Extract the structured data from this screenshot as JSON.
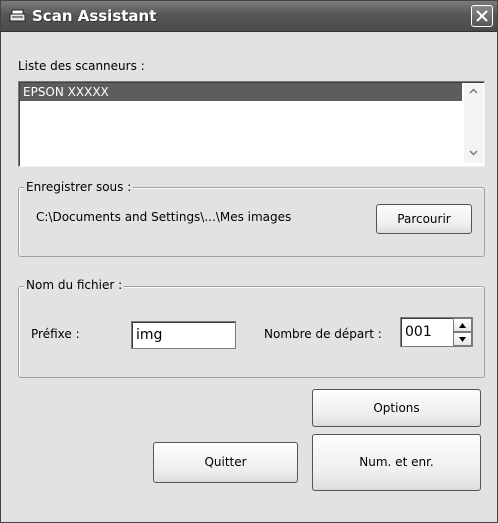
{
  "window": {
    "title": "Scan Assistant"
  },
  "scanners": {
    "label": "Liste des scanneurs :",
    "items": [
      {
        "name": "EPSON XXXXX",
        "selected": true
      }
    ]
  },
  "save": {
    "legend": "Enregistrer sous :",
    "path": "C:\\Documents and Settings\\...\\Mes images",
    "browse_label": "Parcourir"
  },
  "filename": {
    "legend": "Nom du fichier :",
    "prefix_label": "Préfixe :",
    "prefix_value": "img",
    "start_label": "Nombre de départ :",
    "start_value": "001"
  },
  "buttons": {
    "options": "Options",
    "quit": "Quitter",
    "scan_save": "Num. et enr."
  },
  "colors": {
    "titlebar": "#5a5a5a",
    "selection": "#5d5d5d",
    "dialog_bg": "#e2e2e2"
  },
  "icons": {
    "app": "scanner-icon",
    "close": "close-icon"
  }
}
